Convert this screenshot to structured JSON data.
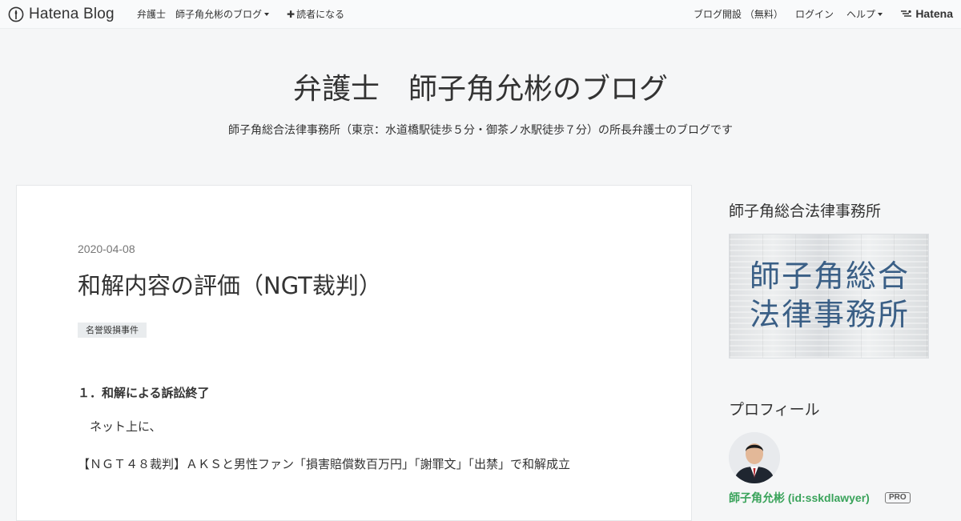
{
  "topbar": {
    "logo_text": "Hatena Blog",
    "links": {
      "lawyer": "弁護士",
      "blog_menu": "師子角允彬のブログ",
      "subscribe": "読者になる",
      "open_blog": "ブログ開設 （無料）",
      "login": "ログイン",
      "help": "ヘルプ",
      "hatena": "Hatena"
    }
  },
  "header": {
    "title": "弁護士　師子角允彬のブログ",
    "description": "師子角総合法律事務所（東京：水道橋駅徒歩５分・御茶ノ水駅徒歩７分）の所長弁護士のブログです"
  },
  "entry": {
    "date": "2020-04-08",
    "title": "和解内容の評価（NGT裁判）",
    "category": "名誉毀損事件",
    "heading": "１．和解による訴訟終了",
    "para1": "　ネット上に、",
    "para2": "【ＮＧＴ４８裁判】ＡＫＳと男性ファン「損害賠償数百万円」「謝罪文」「出禁」で和解成立"
  },
  "sidebar": {
    "office_heading": "師子角総合法律事務所",
    "banner_line1": "師子角総合",
    "banner_line2": "法律事務所",
    "profile_heading": "プロフィール",
    "profile_name": "師子角允彬 (id:sskdlawyer)",
    "pro_badge": "PRO"
  },
  "colors": {
    "background": "#f5f6f7",
    "text": "#333333",
    "accent_green": "#3aa35b",
    "banner_text": "#3a5f86"
  }
}
